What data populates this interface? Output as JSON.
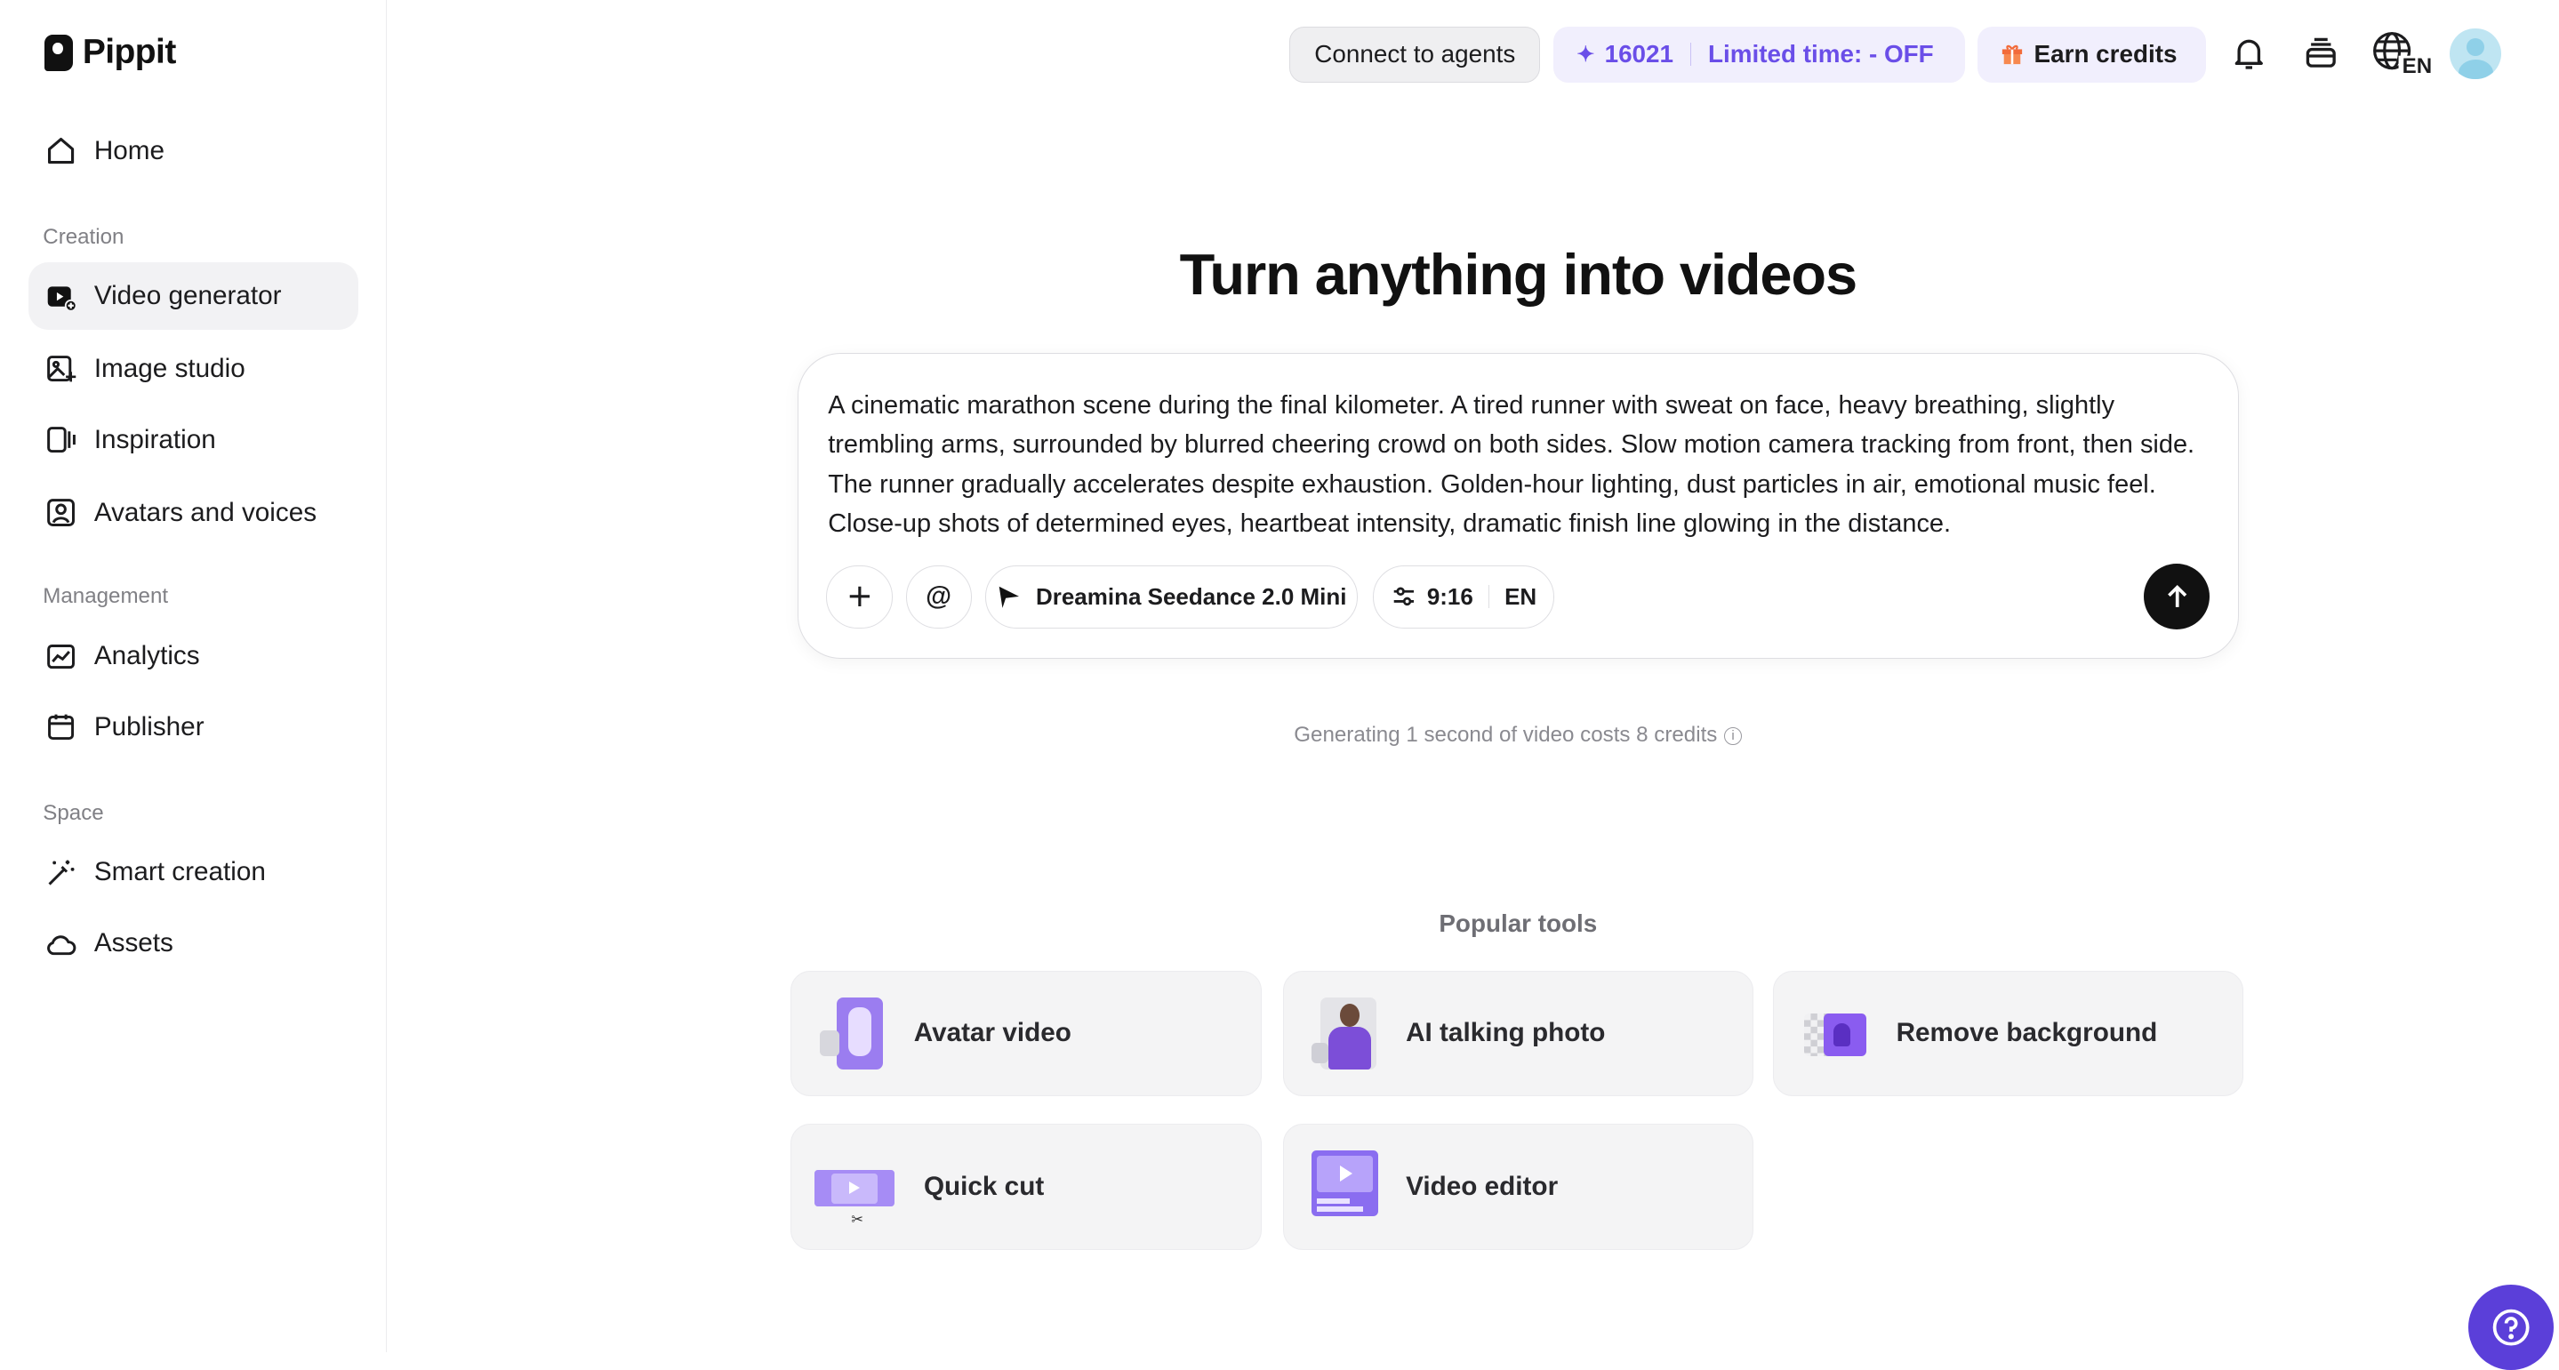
{
  "brand": {
    "name": "Pippit"
  },
  "sidebar": {
    "home": "Home",
    "sections": [
      {
        "label": "Creation"
      },
      {
        "label": "Management"
      },
      {
        "label": "Space"
      }
    ],
    "items": [
      {
        "label": "Video generator",
        "icon": "video-plus-icon",
        "active": true
      },
      {
        "label": "Image studio",
        "icon": "image-sparkle-icon"
      },
      {
        "label": "Inspiration",
        "icon": "inspiration-icon"
      },
      {
        "label": "Avatars and voices",
        "icon": "avatar-voice-icon"
      },
      {
        "label": "Analytics",
        "icon": "chart-line-icon"
      },
      {
        "label": "Publisher",
        "icon": "calendar-icon"
      },
      {
        "label": "Smart creation",
        "icon": "magic-wand-icon"
      },
      {
        "label": "Assets",
        "icon": "cloud-icon"
      }
    ]
  },
  "topbar": {
    "connect_label": "Connect to agents",
    "credits_value": "16021",
    "promo_label": "Limited time: - OFF",
    "earn_label": "Earn credits",
    "language": "EN"
  },
  "main": {
    "headline": "Turn anything into videos",
    "prompt": "A cinematic marathon scene during the final kilometer. A tired runner with sweat on face, heavy breathing, slightly trembling arms, surrounded by blurred cheering crowd on both sides. Slow motion camera tracking from front, then side. The runner gradually accelerates despite exhaustion. Golden-hour lighting, dust particles in air, emotional music feel. Close-up shots of determined eyes, heartbeat intensity, dramatic finish line glowing in the distance.",
    "mention_label": "@",
    "model_label": "Dreamina Seedance 2.0 Mini",
    "aspect_label": "9:16",
    "lang_label": "EN",
    "cost_note": "Generating 1 second of video costs 8 credits",
    "popular_title": "Popular tools",
    "tools": [
      {
        "label": "Avatar video"
      },
      {
        "label": "AI talking photo"
      },
      {
        "label": "Remove background"
      },
      {
        "label": "Quick cut"
      },
      {
        "label": "Video editor"
      }
    ]
  },
  "colors": {
    "accent": "#6a4ee8",
    "help_button": "#5b3fd9",
    "active_nav_bg": "#f2f2f4"
  }
}
